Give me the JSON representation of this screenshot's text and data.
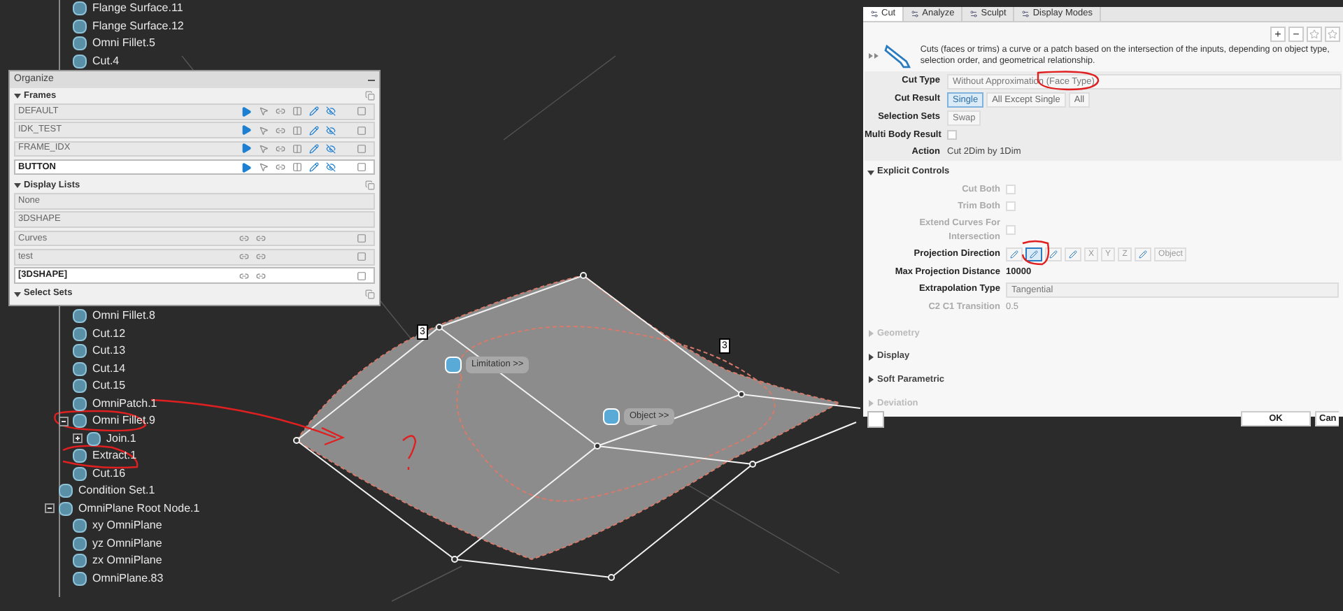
{
  "tree": [
    {
      "children": [
        {
          "label": "Flange Surface.11"
        },
        {
          "label": "Flange Surface.12"
        },
        {
          "label": "Omni Fillet.5"
        },
        {
          "label": "Cut.4"
        },
        {
          "label": "Omni Fillet.8"
        },
        {
          "label": "Cut.12"
        },
        {
          "label": "Cut.13"
        },
        {
          "label": "Cut.14"
        },
        {
          "label": "Cut.15"
        },
        {
          "label": "OmniPatch.1"
        },
        {
          "label": "Omni Fillet.9",
          "expanded": true,
          "children": [
            {
              "label": "Join.1",
              "expanded": false
            }
          ]
        },
        {
          "label": "Extract.1"
        },
        {
          "label": "Cut.16"
        }
      ]
    },
    {
      "label": "Condition Set.1"
    },
    {
      "label": "OmniPlane Root Node.1",
      "expanded": true,
      "children": [
        {
          "label": "xy OmniPlane"
        },
        {
          "label": "yz OmniPlane"
        },
        {
          "label": "zx OmniPlane"
        },
        {
          "label": "OmniPlane.83"
        }
      ]
    }
  ],
  "organize": {
    "title": "Organize",
    "sections": [
      {
        "title": "Frames",
        "expanded": true,
        "rows": [
          {
            "name": "DEFAULT",
            "selected": false,
            "kind": "frame"
          },
          {
            "name": "IDK_TEST",
            "selected": false,
            "kind": "frame"
          },
          {
            "name": "FRAME_IDX",
            "selected": false,
            "kind": "frame"
          },
          {
            "name": "BUTTON",
            "selected": true,
            "kind": "frame"
          }
        ]
      },
      {
        "title": "Display Lists",
        "expanded": true,
        "rows": [
          {
            "name": "None",
            "selected": false,
            "kind": "plain"
          },
          {
            "name": "3DSHAPE",
            "selected": false,
            "kind": "plain"
          },
          {
            "name": "Curves",
            "selected": false,
            "kind": "linked"
          },
          {
            "name": "test",
            "selected": false,
            "kind": "linked"
          },
          {
            "name": "[3DSHAPE]",
            "selected": true,
            "kind": "linked"
          }
        ]
      },
      {
        "title": "Select Sets",
        "expanded": true
      }
    ]
  },
  "viewport": {
    "labels": [
      {
        "text": "Limitation >>"
      },
      {
        "text": "Object >>"
      }
    ],
    "markers": [
      "3",
      "3"
    ]
  },
  "panel": {
    "tabs": [
      {
        "label": "Cut",
        "selected": true
      },
      {
        "label": "Analyze",
        "selected": false
      },
      {
        "label": "Sculpt",
        "selected": false
      },
      {
        "label": "Display Modes",
        "selected": false
      }
    ],
    "toolbar": [
      "+",
      "−"
    ],
    "description": "Cuts (faces or trims) a curve or a patch based on the intersection of the inputs, depending on object type, selection order, and geometrical relationship.",
    "cut_type": {
      "label": "Cut Type",
      "value": "Without Approximation (Face Type)"
    },
    "cut_result": {
      "label": "Cut Result",
      "options": [
        {
          "label": "Single",
          "selected": true
        },
        {
          "label": "All Except Single",
          "selected": false
        },
        {
          "label": "All",
          "selected": false
        }
      ]
    },
    "selection_sets": {
      "label": "Selection Sets",
      "button": "Swap"
    },
    "multi_body": {
      "label": "Multi Body Result",
      "checked": false
    },
    "action": {
      "label": "Action",
      "value": "Cut 2Dim by 1Dim"
    },
    "explicit": {
      "title": "Explicit Controls",
      "expanded": true,
      "checks": [
        {
          "label": "Cut Both",
          "checked": false,
          "disabled": true
        },
        {
          "label": "Trim Both",
          "checked": false,
          "disabled": true
        },
        {
          "label": "Extend Curves For Intersection",
          "checked": false,
          "disabled": true
        }
      ],
      "projection": {
        "label": "Projection Direction",
        "buttons": [
          {
            "kind": "icon",
            "selected": false
          },
          {
            "kind": "icon",
            "selected": true
          },
          {
            "kind": "icon",
            "selected": false
          },
          {
            "kind": "icon",
            "selected": false
          },
          {
            "kind": "text",
            "text": "X",
            "selected": false
          },
          {
            "kind": "text",
            "text": "Y",
            "selected": false
          },
          {
            "kind": "text",
            "text": "Z",
            "selected": false
          },
          {
            "kind": "icon",
            "selected": false
          },
          {
            "kind": "text",
            "text": "Object",
            "selected": false
          }
        ]
      },
      "max_distance": {
        "label": "Max Projection Distance",
        "value": "10000"
      },
      "extrapolation": {
        "label": "Extrapolation Type",
        "value": "Tangential"
      },
      "transition": {
        "label": "C2 C1 Transition",
        "value": "0.5",
        "disabled": true
      }
    },
    "sections": [
      {
        "title": "Geometry",
        "disabled": true
      },
      {
        "title": "Display",
        "disabled": false
      },
      {
        "title": "Soft Parametric",
        "disabled": false
      },
      {
        "title": "Deviation",
        "disabled": true
      }
    ],
    "ok": "OK",
    "cancel": "Can"
  }
}
